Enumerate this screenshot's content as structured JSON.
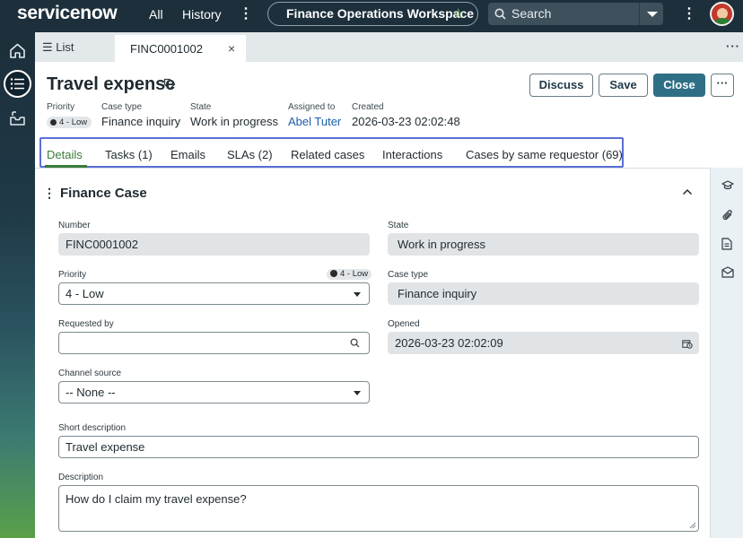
{
  "topnav": {
    "logo": "servicenow",
    "all_label": "All",
    "history_label": "History",
    "workspace_label": "Finance Operations Workspace",
    "search_placeholder": "Search"
  },
  "tabs": {
    "list_label": "List",
    "record_tab_label": "FINC0001002",
    "close_glyph": "×",
    "more_glyph": "···"
  },
  "header": {
    "title": "Travel expense",
    "buttons": {
      "discuss": "Discuss",
      "save": "Save",
      "close": "Close",
      "more": "···"
    },
    "meta": {
      "priority_label": "Priority",
      "priority_value": "4 - Low",
      "case_type_label": "Case type",
      "case_type_value": "Finance inquiry",
      "state_label": "State",
      "state_value": "Work in progress",
      "assigned_to_label": "Assigned to",
      "assigned_to_value": "Abel Tuter",
      "created_label": "Created",
      "created_value": "2026-03-23 02:02:48"
    }
  },
  "subtabs": [
    {
      "label": "Details"
    },
    {
      "label": "Tasks (1)"
    },
    {
      "label": "Emails"
    },
    {
      "label": "SLAs (2)"
    },
    {
      "label": "Related cases"
    },
    {
      "label": "Interactions"
    },
    {
      "label": "Cases by same requestor (69)"
    }
  ],
  "form": {
    "section_title": "Finance Case",
    "number_label": "Number",
    "number_value": "FINC0001002",
    "state_label": "State",
    "state_value": "Work in progress",
    "priority_label": "Priority",
    "priority_badge": "4 - Low",
    "priority_value": "4 - Low",
    "case_type_label": "Case type",
    "case_type_value": "Finance inquiry",
    "requested_by_label": "Requested by",
    "requested_by_value": "",
    "opened_label": "Opened",
    "opened_value": "2026-03-23 02:02:09",
    "channel_source_label": "Channel source",
    "channel_source_value": "-- None --",
    "short_description_label": "Short description",
    "short_description_value": "Travel expense",
    "description_label": "Description",
    "description_value": "How do I claim my travel expense?"
  },
  "colors": {
    "nav_bg": "#1c2f3b",
    "accent_green": "#3b7c3a",
    "primary_button": "#2f6f86",
    "link_blue": "#1a5ea8",
    "highlight_box": "#5b6fd6"
  }
}
